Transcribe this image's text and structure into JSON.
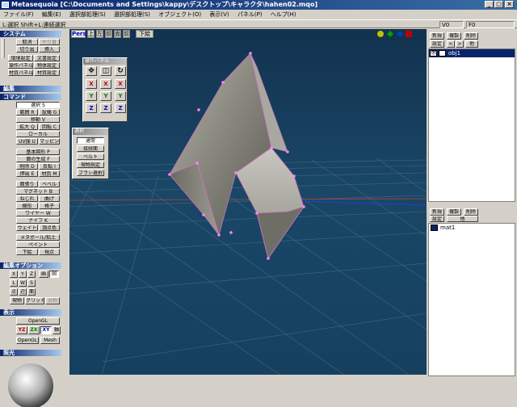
{
  "window": {
    "title": "Metasequoia [C:\\Documents and Settings\\kappy\\デスクトップ\\キャラクタ\\hahen02.mqo]",
    "min": "_",
    "max": "□",
    "close": "×"
  },
  "menu": [
    "ファイル(F)",
    "編集(E)",
    "選択部処理(S)",
    "選択部処理(S)",
    "オブジェクト(O)",
    "表示(V)",
    "パネル(P)",
    "ヘルプ(H)"
  ],
  "status": {
    "hint": "L:選択  Shift+L:連続選択",
    "v": "V0",
    "f": "F0"
  },
  "left": {
    "system": {
      "title": "システム",
      "undo": "取消",
      "redo": "やり直",
      "cut": "切り出",
      "paste": "挿入",
      "env": "環境設定",
      "doc": "文書設定",
      "oper": "操作パネル",
      "objset": "物体設定",
      "mat": "材質パネル",
      "matset": "材質設定"
    },
    "edit": {
      "title": "編集"
    },
    "command": {
      "title": "コマンド",
      "select": "選択 S",
      "rect": "範囲 R",
      "lasso": "投縄 G",
      "move": "移動 V",
      "scale": "拡大 Q",
      "rotate": "回転 C",
      "local": "ローカル",
      "uv": "UV操 U",
      "map": "マッピング"
    },
    "create": {
      "basic": "基本図形 P",
      "face": "面の生成 F",
      "del": "削除 D",
      "flip": "反転 I",
      "extrude": "押出 E",
      "mat": "材質 M"
    },
    "modify": {
      "face": "面張り",
      "bevel": "ベベル",
      "magnet": "マグネット B",
      "twist": "ねじれ",
      "bend": "曲げ",
      "knife": "線形",
      "lattice": "格子",
      "wire": "ワイヤー W",
      "knife2": "ナイフ K",
      "weight": "ウェイト",
      "vcolor": "頂点色",
      "metaball": "メタボール/粘土",
      "paint": "ペイント",
      "draw": "下絵",
      "view": "視点"
    },
    "editopt": {
      "title": "編集オプション",
      "x": "X",
      "y": "Y",
      "z": "Z",
      "scr": "画",
      "opt": "固",
      "l": "L",
      "w": "W",
      "s": "S",
      "pt": "点",
      "ln": "辺",
      "fc": "面",
      "cur": "現物",
      "grid": "グリッド",
      "sym": "対称"
    },
    "display": {
      "title": "表示",
      "opengl": "OpenGL",
      "yz": "YZ",
      "zx": "ZX",
      "xy": "XY",
      "axis": "軸",
      "opengl2": "OpenGL",
      "mesh": "Mesh"
    },
    "light": {
      "title": "照光"
    }
  },
  "viewport": {
    "persp": "Pers",
    "v1": "上",
    "v2": "左",
    "v3": "前",
    "v4": "面",
    "v5": "前",
    "draw": "下絵"
  },
  "oppanel": {
    "title": "操作パネル",
    "x": "X",
    "y": "Y",
    "z": "Z"
  },
  "selpanel": {
    "title": "選択",
    "normal": "通常",
    "contact": "接続面",
    "belt": "ベルト",
    "cur": "現物指定",
    "brush": "ブラシ選択"
  },
  "objpanel": {
    "new": "新規",
    "copy": "複製",
    "del": "削除",
    "set": "設定",
    "prev": "<",
    "next": ">",
    "all": "他",
    "item": "obj1"
  },
  "matpanel": {
    "new": "新規",
    "copy": "複製",
    "del": "削除",
    "set": "設定",
    "other": "他",
    "item": "mat1"
  }
}
